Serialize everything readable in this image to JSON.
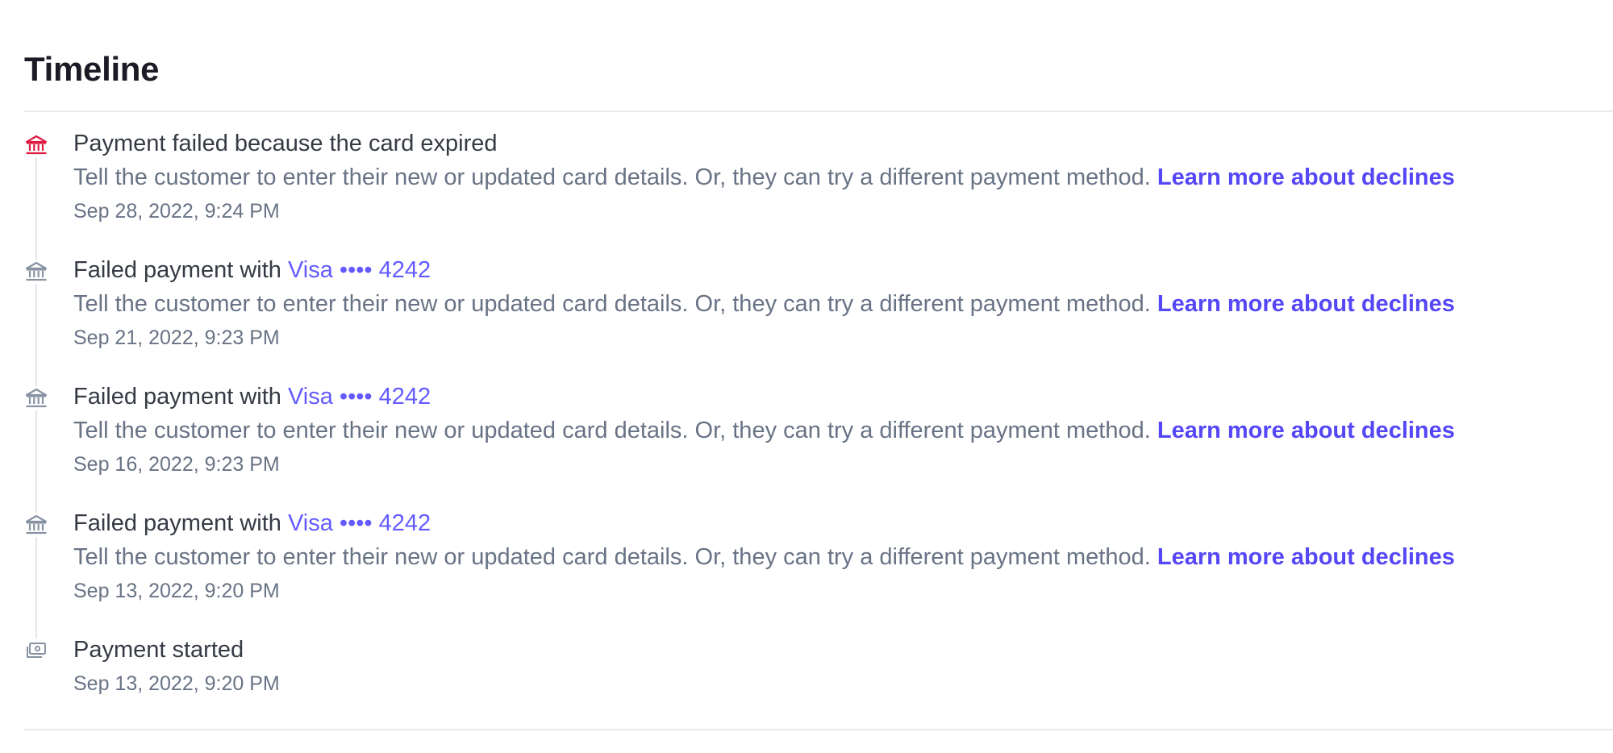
{
  "timeline": {
    "title": "Timeline",
    "events": [
      {
        "icon": "bank-icon",
        "icon_color": "#df1b41",
        "title": "Payment failed because the card expired",
        "description": "Tell the customer to enter their new or updated card details. Or, they can try a different payment method.",
        "link": "Learn more about declines",
        "date": "Sep 28, 2022, 9:24 PM"
      },
      {
        "icon": "bank-icon",
        "icon_color": "#8792a2",
        "title_prefix": "Failed payment with",
        "card_link": "Visa •••• 4242",
        "description": "Tell the customer to enter their new or updated card details. Or, they can try a different payment method.",
        "link": "Learn more about declines",
        "date": "Sep 21, 2022, 9:23 PM"
      },
      {
        "icon": "bank-icon",
        "icon_color": "#8792a2",
        "title_prefix": "Failed payment with",
        "card_link": "Visa •••• 4242",
        "description": "Tell the customer to enter their new or updated card details. Or, they can try a different payment method.",
        "link": "Learn more about declines",
        "date": "Sep 16, 2022, 9:23 PM"
      },
      {
        "icon": "bank-icon",
        "icon_color": "#8792a2",
        "title_prefix": "Failed payment with",
        "card_link": "Visa •••• 4242",
        "description": "Tell the customer to enter their new or updated card details. Or, they can try a different payment method.",
        "link": "Learn more about declines",
        "date": "Sep 13, 2022, 9:20 PM"
      },
      {
        "icon": "payment-started-icon",
        "icon_color": "#8792a2",
        "title": "Payment started",
        "date": "Sep 13, 2022, 9:20 PM"
      }
    ]
  },
  "colors": {
    "accent": "#635bff",
    "error": "#df1b41",
    "muted": "#687385"
  }
}
